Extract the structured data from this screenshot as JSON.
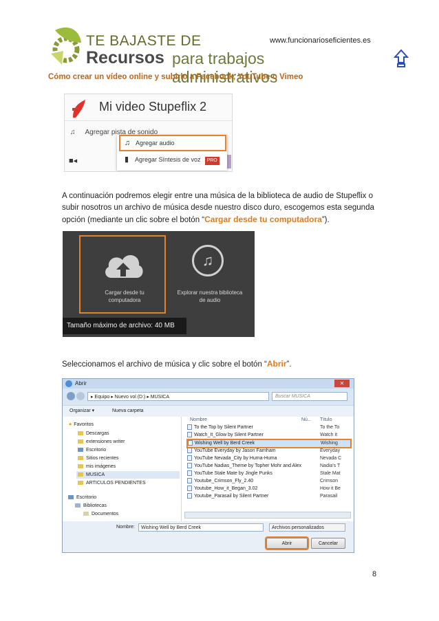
{
  "header": {
    "site_url": "www.funcionarioseficientes.es",
    "logo_line1": "TE BAJASTE DE",
    "logo_line2": "Recursos",
    "logo_line3": "para trabajos administrativos",
    "doc_title": "Cómo crear un vídeo online y subirlo a Facebook, YouTube o Vimeo"
  },
  "shot1": {
    "project_title": "Mi video Stupeflix 2",
    "add_track_label": "Agregar pista de sonido",
    "menu_items": [
      "Agregar audio",
      "Agregar Síntesis de voz"
    ],
    "pro_badge": "PRO"
  },
  "paragraph1": {
    "text_before": "A continuación podremos elegir entre una música de la biblioteca de audio de Stupeflix o subir nosotros un archivo de música desde nuestro disco duro, escogemos esta segunda opción (mediante un clic sobre el botón “",
    "highlight": "Cargar desde tu computadora",
    "text_after": "”)."
  },
  "shot2": {
    "upload_label_1": "Cargar desde tu",
    "upload_label_2": "computadora",
    "library_label_1": "Explorar nuestra biblioteca",
    "library_label_2": "de audio",
    "tooltip": "Tamaño máximo de archivo: 40 MB"
  },
  "paragraph2": {
    "text_before": "Seleccionamos el archivo de música y clic sobre el botón “",
    "highlight": "Abrir",
    "text_after": "”."
  },
  "dialog": {
    "title": "Abrir",
    "close": "✕",
    "address": "▸ Equipo ▸ Nuevo vol (D:) ▸ MUSICA",
    "search_placeholder": "Buscar MUSICA",
    "toolbar_organize": "Organizar ▾",
    "toolbar_new_folder": "Nueva carpeta",
    "nav": [
      "Favoritos",
      "Descargas",
      "extensiones writer",
      "Escritorio",
      "Sitios recientes",
      "mis imágenes",
      "MUSICA",
      "ARTICULOS PENDIENTES",
      "Escritorio",
      "Bibliotecas",
      "Documentos"
    ],
    "columns": [
      "Nombre",
      "Nú...",
      "Título"
    ],
    "files": [
      {
        "name": "To the Top by Silent Partner",
        "title": "To the To"
      },
      {
        "name": "Watch_It_Glow by Silent Partner",
        "title": "Watch it"
      },
      {
        "name": "Wishing Well by Berd Creek",
        "title": "Wishing"
      },
      {
        "name": "YouTube  Everyday by Jason Farnham",
        "title": "Everyday"
      },
      {
        "name": "YouTube  Nevada_City by Huma-Huma",
        "title": "Nevada C"
      },
      {
        "name": "YouTube Nadias_Theme by Topher Mohr and Alex",
        "title": "Nadia's T"
      },
      {
        "name": "YouTube Stale Mate by Jingle Punks",
        "title": "Stale Mat"
      },
      {
        "name": "Youtube_Crimson_Fly_2.40",
        "title": "Crimson"
      },
      {
        "name": "Youtube_How_it_Began_3.02",
        "title": "How it Be"
      },
      {
        "name": "Youtube_Parasail by Silent Partner",
        "title": "Parasail"
      }
    ],
    "filename_label": "Nombre:",
    "filename_value": "Wishing Well by Berd Creek",
    "filetype_value": "Archivos personalizados",
    "open_button": "Abrir",
    "cancel_button": "Cancelar"
  },
  "page_number": "8",
  "colors": {
    "accent": "#e8812b",
    "title": "#c0661a"
  }
}
